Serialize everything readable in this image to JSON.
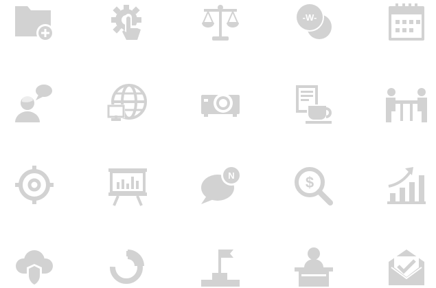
{
  "colors": {
    "icon": "#d2d2d2",
    "background": "#ffffff"
  },
  "icons": [
    "folder-add-icon",
    "settings-touch-icon",
    "justice-scale-icon",
    "won-coins-icon",
    "calendar-icon",
    "user-chat-icon",
    "global-network-icon",
    "projector-icon",
    "coffee-document-icon",
    "meeting-icon",
    "target-icon",
    "presentation-board-icon",
    "notification-chat-icon",
    "dollar-search-icon",
    "growth-chart-icon",
    "cloud-security-icon",
    "donut-chart-icon",
    "flag-goal-icon",
    "speaker-podium-icon",
    "email-check-icon"
  ],
  "labels": {
    "won_symbol": "-W-",
    "notification_letter": "N",
    "dollar_symbol": "$"
  }
}
